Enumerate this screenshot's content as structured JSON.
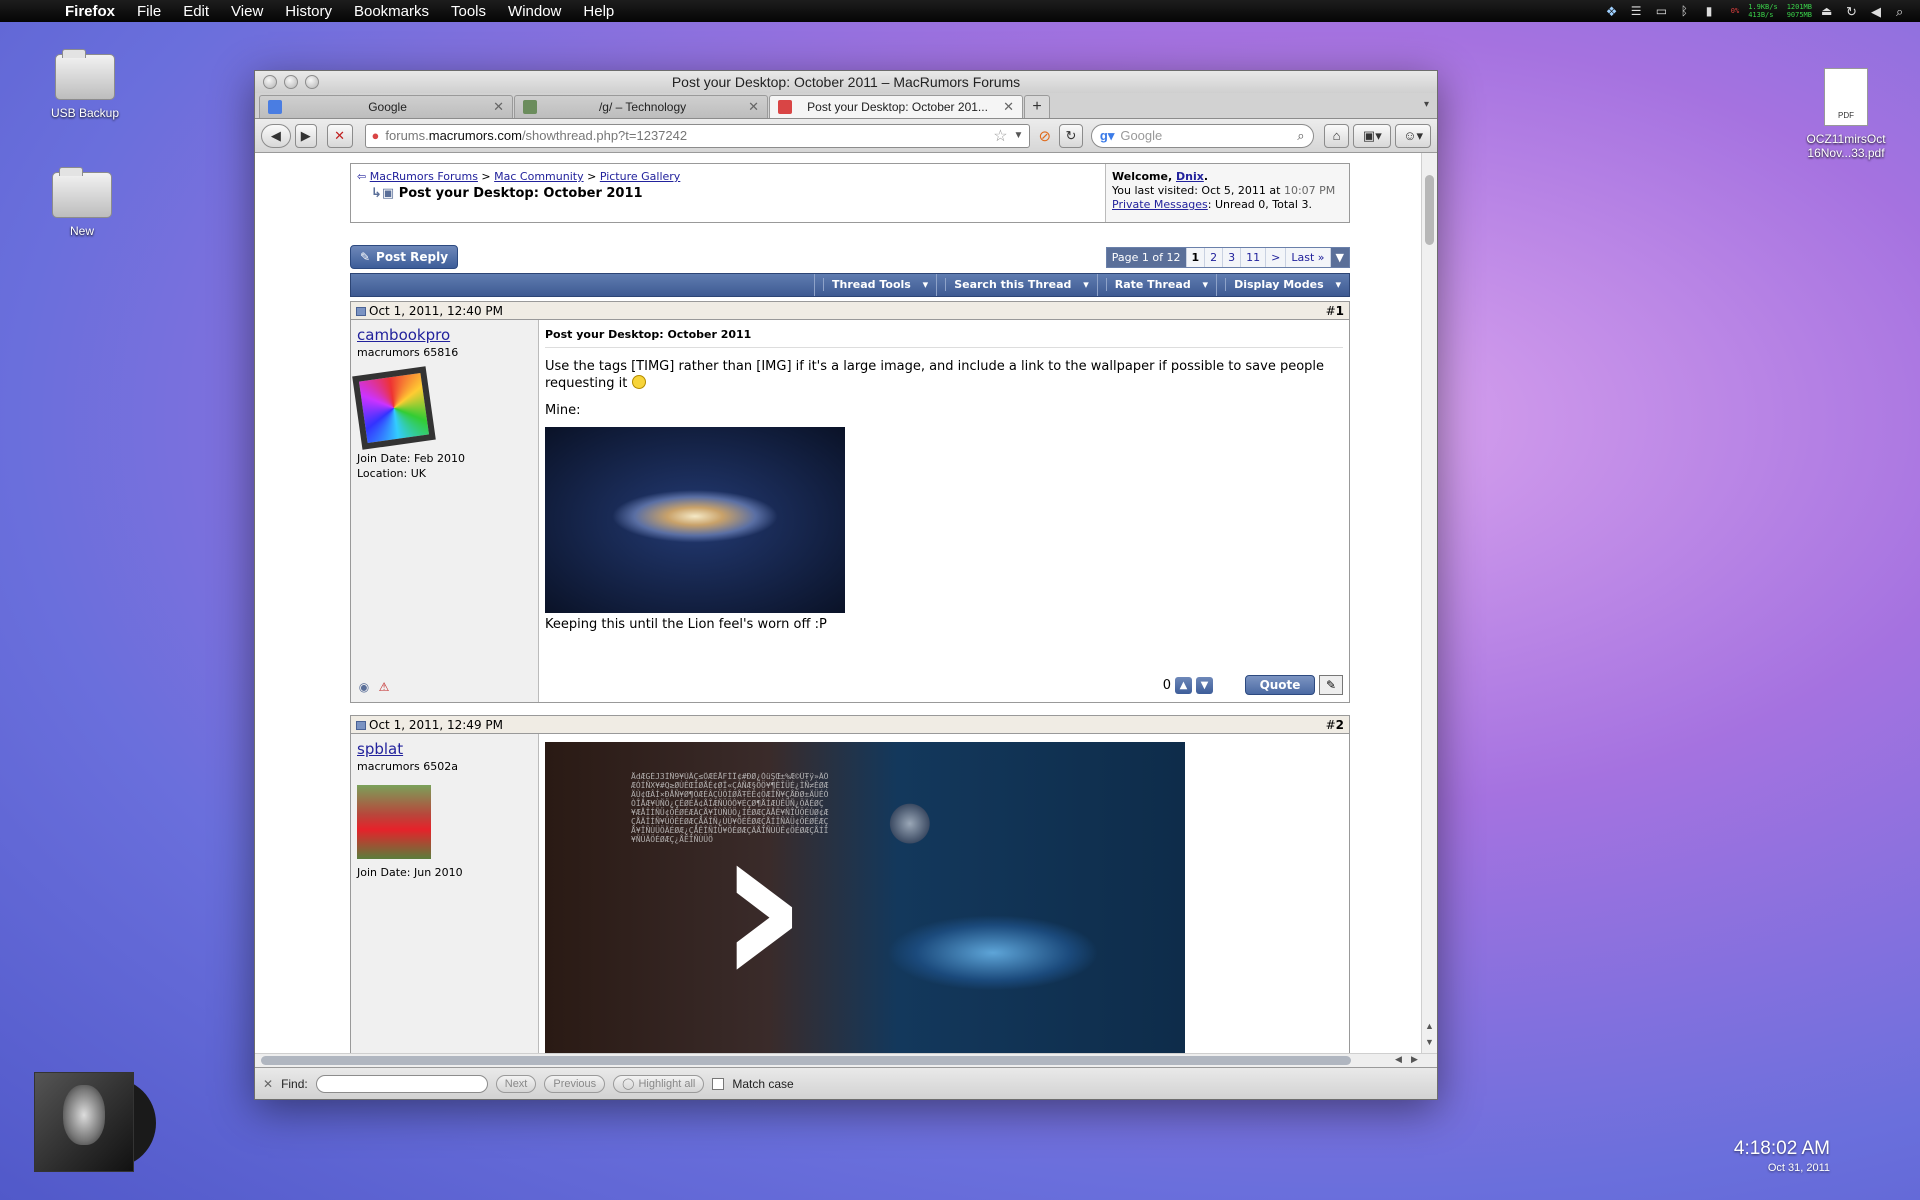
{
  "menubar": {
    "app": "Firefox",
    "items": [
      "File",
      "Edit",
      "View",
      "History",
      "Bookmarks",
      "Tools",
      "Window",
      "Help"
    ],
    "netstat": {
      "tx": "1.9KB/s",
      "rx": "413B/s",
      "mem1": "1201MB",
      "mem2": "9075MB",
      "pct": "0%"
    }
  },
  "desktop": {
    "icons": [
      {
        "label": "USB Backup"
      },
      {
        "label": "New"
      }
    ],
    "pdf": {
      "label_line1": "OCZ11mirsOct",
      "label_line2": "16Nov...33.pdf",
      "badge": "PDF"
    },
    "clock": {
      "time": "4:18:02 AM",
      "date": "Oct 31, 2011"
    }
  },
  "browser": {
    "window_title": "Post your Desktop: October 2011 – MacRumors Forums",
    "tabs": [
      {
        "label": "Google",
        "favicon_color": "#4a7de2"
      },
      {
        "label": "/g/ – Technology",
        "favicon_color": "#6b8c5c"
      },
      {
        "label": "Post your Desktop: October 201...",
        "favicon_color": "#d94545"
      }
    ],
    "url": {
      "prefix": "forums.",
      "domain": "macrumors.com",
      "path": "/showthread.php?t=1237242"
    },
    "search_placeholder": "Google",
    "findbar": {
      "label": "Find:",
      "next": "Next",
      "previous": "Previous",
      "highlight": "Highlight all",
      "match_case": "Match case"
    }
  },
  "forum": {
    "breadcrumb": [
      "MacRumors Forums",
      "Mac Community",
      "Picture Gallery"
    ],
    "thread_title": "Post your Desktop: October 2011",
    "welcome": {
      "prefix": "Welcome,",
      "user": "Dnix",
      "suffix": ".",
      "last_visited_label": "You last visited: Oct 5, 2011 at",
      "last_visited_time": "10:07 PM",
      "pm_link": "Private Messages",
      "pm_counts": ": Unread 0, Total 3."
    },
    "post_reply": "Post Reply",
    "pagenav": {
      "label": "Page 1 of 12",
      "pages": [
        "1",
        "2",
        "3",
        "11",
        ">",
        "Last »"
      ],
      "current": "1"
    },
    "toolbar": [
      "Thread Tools",
      "Search this Thread",
      "Rate Thread",
      "Display Modes"
    ],
    "posts": [
      {
        "date": "Oct 1, 2011, 12:40 PM",
        "num_prefix": "#",
        "num": "1",
        "username": "cambookpro",
        "usertitle": "macrumors 65816",
        "join": "Join Date: Feb 2010",
        "location": "Location: UK",
        "title": "Post your Desktop: October 2011",
        "text1": "Use the tags [TIMG] rather than [IMG] if it's a large image, and include a link to the wallpaper if possible to save people requesting it",
        "text2": "Mine:",
        "caption": "Keeping this until the Lion feel's worn off :P",
        "votes": "0",
        "quote": "Quote"
      },
      {
        "date": "Oct 1, 2011, 12:49 PM",
        "num_prefix": "#",
        "num": "2",
        "username": "spblat",
        "usertitle": "macrumors 6502a",
        "join": "Join Date: Jun 2010"
      }
    ]
  }
}
